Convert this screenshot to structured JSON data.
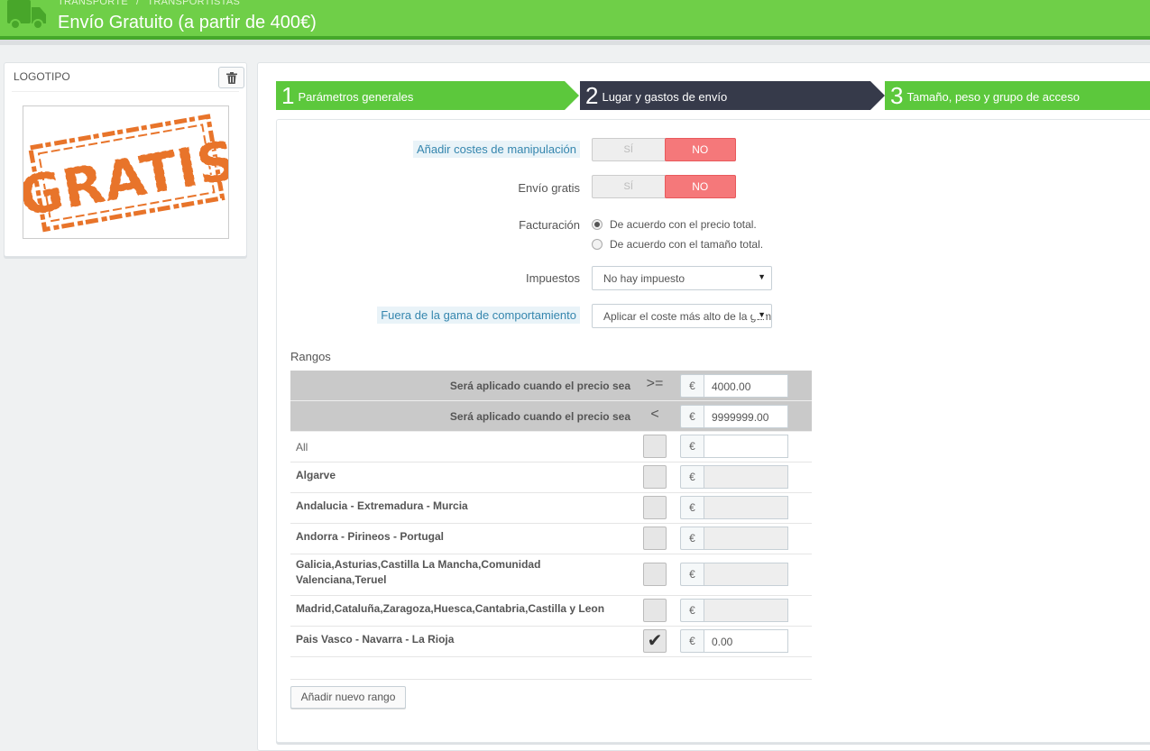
{
  "header": {
    "breadcrumb": [
      "TRANSPORTE",
      "TRANSPORTISTAS"
    ],
    "breadcrumb_sep": "/",
    "title": "Envío Gratuito (a partir de 400€)",
    "icon": "truck-icon",
    "color": "#6fcf48"
  },
  "logo": {
    "header": "LOGOTIPO",
    "image_text": "GRATIS",
    "delete_icon": "trash-icon"
  },
  "steps": [
    {
      "num": "1",
      "label": "Parámetros generales",
      "state": "done"
    },
    {
      "num": "2",
      "label": "Lugar y gastos de envío",
      "state": "active"
    },
    {
      "num": "3",
      "label": "Tamaño, peso y grupo de acceso",
      "state": "done"
    }
  ],
  "form": {
    "handling": {
      "label": "Añadir costes de manipulación",
      "yes": "SÍ",
      "no": "NO",
      "value": "NO"
    },
    "free_shipping": {
      "label": "Envío gratis",
      "yes": "SÍ",
      "no": "NO",
      "value": "NO"
    },
    "billing": {
      "label": "Facturación",
      "options": [
        "De acuerdo con el precio total.",
        "De acuerdo con el tamaño total."
      ],
      "selected": 0
    },
    "tax": {
      "label": "Impuestos",
      "value": "No hay impuesto"
    },
    "out_of_range": {
      "label": "Fuera de la gama de comportamiento",
      "value": "Aplicar el coste más alto de la gama"
    }
  },
  "ranges": {
    "title": "Rangos",
    "currency": "€",
    "from": {
      "label": "Será aplicado cuando el precio sea",
      "op": ">=",
      "value": "4000.00"
    },
    "to": {
      "label": "Será aplicado cuando el precio sea",
      "op": "<",
      "value": "9999999.00"
    },
    "zones": [
      {
        "name": "All",
        "checked": false,
        "value": "",
        "disabled": false
      },
      {
        "name": "Algarve",
        "checked": false,
        "value": "",
        "disabled": true
      },
      {
        "name": "Andalucia - Extremadura - Murcia",
        "checked": false,
        "value": "",
        "disabled": true
      },
      {
        "name": "Andorra - Pirineos - Portugal",
        "checked": false,
        "value": "",
        "disabled": true
      },
      {
        "name": "Galicia,Asturias,Castilla La Mancha,Comunidad Valenciana,Teruel",
        "checked": false,
        "value": "",
        "disabled": true
      },
      {
        "name": "Madrid,Cataluña,Zaragoza,Huesca,Cantabria,Castilla y Leon",
        "checked": false,
        "value": "",
        "disabled": true
      },
      {
        "name": "Pais Vasco - Navarra - La Rioja",
        "checked": true,
        "value": "0.00",
        "disabled": false
      }
    ],
    "add_button": "Añadir nuevo rango"
  }
}
